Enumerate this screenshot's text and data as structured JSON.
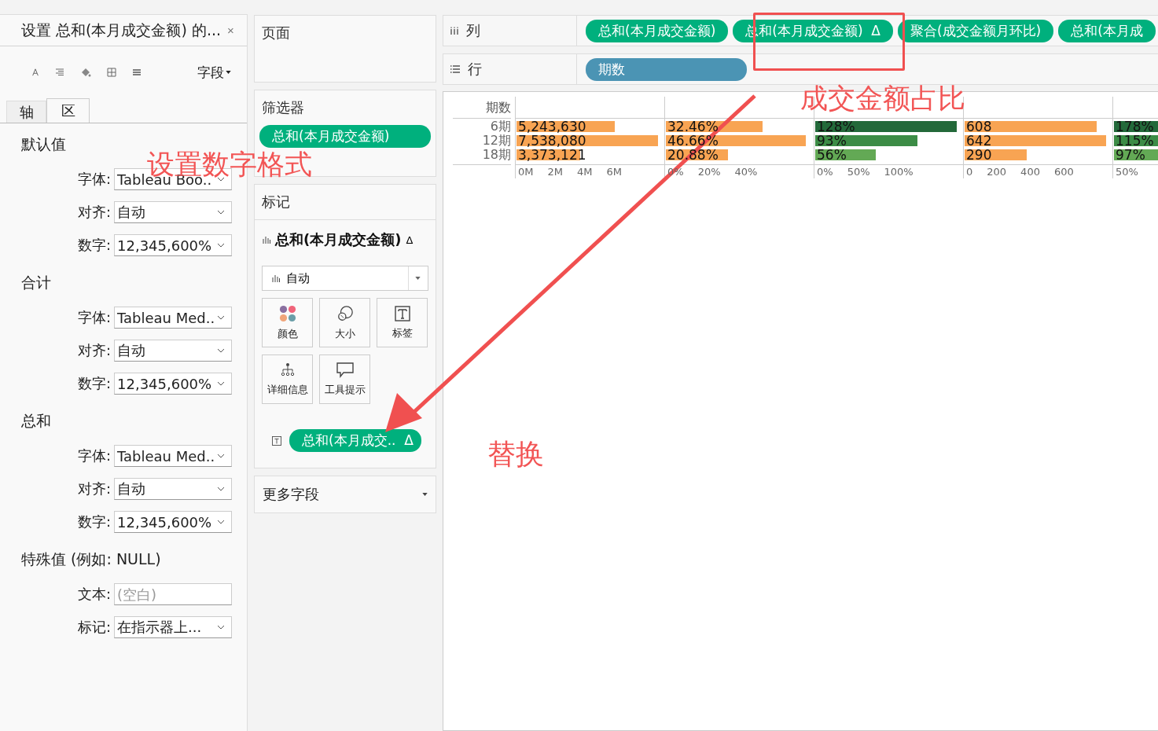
{
  "format_panel": {
    "title": "设置 总和(本月成交金额) 的...",
    "close": "×",
    "field_menu": "字段",
    "tabs": [
      {
        "label": "轴",
        "selected": false
      },
      {
        "label": "区",
        "selected": true
      }
    ],
    "sections": [
      {
        "heading": "默认值",
        "rows": [
          {
            "label": "字体:",
            "value": "Tableau Boo..",
            "kind": "dropdown"
          },
          {
            "label": "对齐:",
            "value": "自动",
            "kind": "dropdown"
          },
          {
            "label": "数字:",
            "value": "12,345,600%",
            "kind": "dropdown"
          }
        ]
      },
      {
        "heading": "合计",
        "rows": [
          {
            "label": "字体:",
            "value": "Tableau Med..",
            "kind": "dropdown"
          },
          {
            "label": "对齐:",
            "value": "自动",
            "kind": "dropdown"
          },
          {
            "label": "数字:",
            "value": "12,345,600%",
            "kind": "dropdown"
          }
        ]
      },
      {
        "heading": "总和",
        "rows": [
          {
            "label": "字体:",
            "value": "Tableau Med..",
            "kind": "dropdown"
          },
          {
            "label": "对齐:",
            "value": "自动",
            "kind": "dropdown"
          },
          {
            "label": "数字:",
            "value": "12,345,600%",
            "kind": "dropdown"
          }
        ]
      },
      {
        "heading": "特殊值 (例如: NULL)",
        "rows": [
          {
            "label": "文本:",
            "placeholder": "(空白)",
            "kind": "text"
          },
          {
            "label": "标记:",
            "value": "在指示器上...",
            "kind": "dropdown"
          }
        ]
      }
    ]
  },
  "pages": {
    "title": "页面"
  },
  "filters": {
    "title": "筛选器",
    "pills": [
      "总和(本月成交金额)"
    ]
  },
  "marks": {
    "title": "标记",
    "field": "总和(本月成交金额)",
    "delta": "Δ",
    "mark_type": "自动",
    "cards": [
      {
        "label": "颜色",
        "kind": "color"
      },
      {
        "label": "大小",
        "kind": "size"
      },
      {
        "label": "标签",
        "kind": "label"
      },
      {
        "label": "详细信息",
        "kind": "detail"
      },
      {
        "label": "工具提示",
        "kind": "tooltip"
      }
    ],
    "pills": [
      {
        "text": "总和(本月成交..",
        "delta": "Δ"
      }
    ]
  },
  "more_fields": "更多字段",
  "shelves": [
    {
      "label": "列",
      "kind": "columns",
      "pills": [
        {
          "text": "总和(本月成交金额)",
          "kind": "measure"
        },
        {
          "text": "总和(本月成交金额)",
          "delta": "Δ",
          "kind": "measure"
        },
        {
          "text": "聚合(成交金额月环比)",
          "kind": "measure"
        },
        {
          "text": "总和(本月成",
          "kind": "measure"
        }
      ]
    },
    {
      "label": "行",
      "kind": "rows",
      "pills": [
        {
          "text": "期数",
          "kind": "dimension"
        }
      ]
    }
  ],
  "view": {
    "row_header": "期数",
    "rows": [
      "6期",
      "12期",
      "18期"
    ],
    "panes": [
      {
        "bars": [
          {
            "label": "5,243,630",
            "level": 0.66,
            "color": "#f8a453"
          },
          {
            "label": "7,538,080",
            "level": 0.95,
            "color": "#f8a453"
          },
          {
            "label": "3,373,121",
            "level": 0.43,
            "color": "#f8a453"
          }
        ],
        "ticks": [
          "0M",
          "2M",
          "4M",
          "6M"
        ]
      },
      {
        "bars": [
          {
            "label": "32.46%",
            "level": 0.65,
            "color": "#f8a453"
          },
          {
            "label": "46.66%",
            "level": 0.94,
            "color": "#f8a453"
          },
          {
            "label": "20.88%",
            "level": 0.42,
            "color": "#f8a453"
          }
        ],
        "ticks": [
          "0%",
          "20%",
          "40%"
        ]
      },
      {
        "bars": [
          {
            "label": "128%",
            "level": 0.95,
            "color": "#23693a"
          },
          {
            "label": "93%",
            "level": 0.69,
            "color": "#3c8c46"
          },
          {
            "label": "56%",
            "level": 0.41,
            "color": "#63a955"
          }
        ],
        "ticks": [
          "0%",
          "50%",
          "100%"
        ]
      },
      {
        "bars": [
          {
            "label": "608",
            "level": 0.89,
            "color": "#f8a453"
          },
          {
            "label": "642",
            "level": 0.95,
            "color": "#f8a453"
          },
          {
            "label": "290",
            "level": 0.42,
            "color": "#f8a453"
          }
        ],
        "ticks": [
          "0",
          "200",
          "400",
          "600"
        ]
      },
      {
        "bars": [
          {
            "label": "178%",
            "level": 1,
            "color": "#23693a"
          },
          {
            "label": "115%",
            "level": 1,
            "color": "#3c8c46"
          },
          {
            "label": "97%",
            "level": 1,
            "color": "#63a955"
          }
        ],
        "ticks": [
          "50%"
        ]
      }
    ]
  },
  "annotations": [
    {
      "text": "设置数字格式",
      "kind": "number-format"
    },
    {
      "text": "成交金额占比",
      "kind": "share"
    },
    {
      "text": "替换",
      "kind": "replace"
    }
  ]
}
